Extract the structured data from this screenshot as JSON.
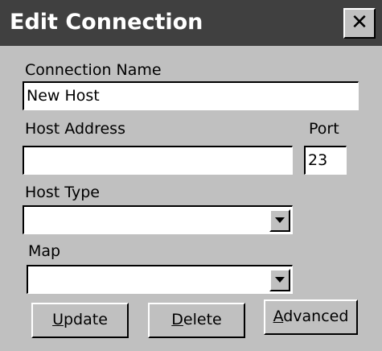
{
  "window": {
    "title": "Edit Connection",
    "close_glyph": "✕"
  },
  "form": {
    "connection_name_label": "Connection Name",
    "connection_name_value": "New Host",
    "host_address_label": "Host Address",
    "host_address_value": "",
    "port_label": "Port",
    "port_value": "23",
    "host_type_label": "Host Type",
    "host_type_value": "",
    "map_label": "Map",
    "map_value": ""
  },
  "buttons": {
    "update": {
      "accel": "U",
      "rest": "pdate"
    },
    "delete": {
      "accel": "D",
      "rest": "elete"
    },
    "advanced": {
      "accel": "A",
      "rest": "dvanced"
    }
  },
  "colors": {
    "titlebar": "#404040",
    "face": "#c0c0c0",
    "field_bg": "#ffffff"
  },
  "icons": {
    "close": "close-icon",
    "dropdown": "chevron-down-icon"
  }
}
